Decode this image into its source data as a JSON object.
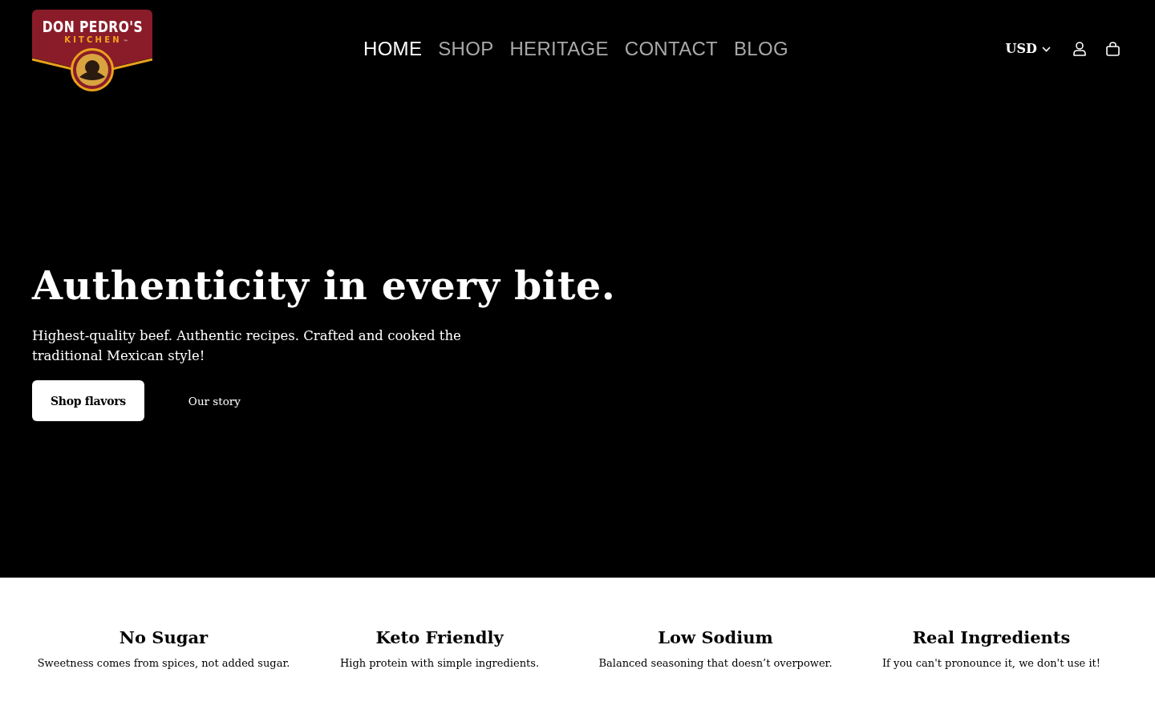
{
  "header": {
    "logo": {
      "title": "DON PEDRO'S",
      "subtitle": "KITCHEN",
      "trademark": "™"
    },
    "nav": [
      {
        "label": "HOME",
        "selected": true
      },
      {
        "label": "SHOP",
        "selected": false
      },
      {
        "label": "HERITAGE",
        "selected": false
      },
      {
        "label": "CONTACT",
        "selected": false
      },
      {
        "label": "BLOG",
        "selected": false
      }
    ],
    "currency": "USD"
  },
  "hero": {
    "title": "Authenticity in every bite.",
    "subtitle": "Highest-quality beef. Authentic recipes. Crafted and cooked the traditional Mexican style!",
    "buttons": [
      {
        "label": "Shop flavors",
        "kind": "primary"
      },
      {
        "label": "Our story",
        "kind": "link"
      }
    ]
  },
  "features": [
    {
      "title": "No Sugar",
      "text": "Sweetness comes from spices, not added sugar."
    },
    {
      "title": "Keto Friendly",
      "text": "High protein with simple ingredients."
    },
    {
      "title": "Low Sodium",
      "text": "Balanced seasoning that doesn’t overpower."
    },
    {
      "title": "Real Ingredients",
      "text": "If you can't pronounce it, we don't use it!"
    }
  ]
}
